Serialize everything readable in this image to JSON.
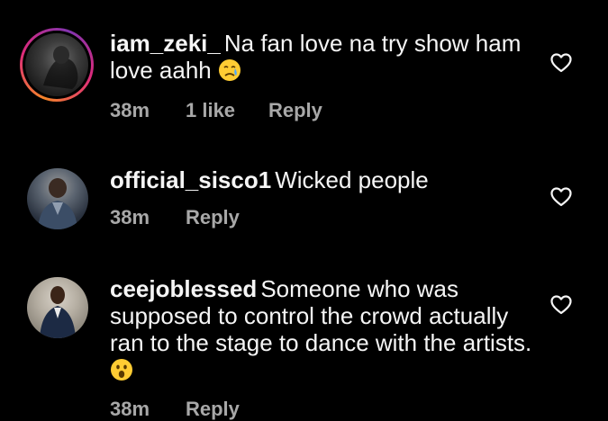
{
  "comments": [
    {
      "username": "iam_zeki_",
      "text": "Na fan love na try show ham love aahh",
      "emoji": "crying-face",
      "time": "38m",
      "likes": "1 like",
      "reply": "Reply",
      "has_story_ring": true
    },
    {
      "username": "official_sisco1",
      "text": "Wicked people",
      "emoji": "",
      "time": "38m",
      "likes": "",
      "reply": "Reply",
      "has_story_ring": false
    },
    {
      "username": "ceejoblessed",
      "text": "Someone who was supposed to control the crowd actually ran to the stage to dance with the artists.",
      "emoji": "astonished-face",
      "time": "38m",
      "likes": "",
      "reply": "Reply",
      "has_story_ring": false
    }
  ],
  "colors": {
    "background": "#000000",
    "text": "#f5f5f5",
    "meta": "#a8a8a8",
    "ring_start": "#f58529",
    "ring_end": "#dd2a7b"
  }
}
